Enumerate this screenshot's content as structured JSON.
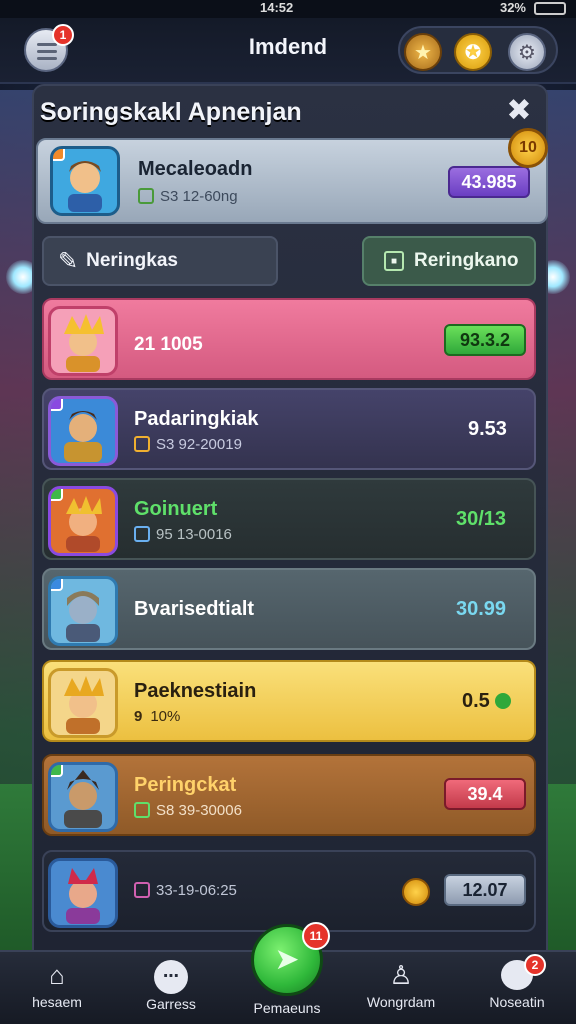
{
  "status_bar": {
    "time": "14:52",
    "right": "32%"
  },
  "header": {
    "title": "Imdend",
    "menu_badge": "1",
    "icons": [
      "star-icon",
      "badge-icon",
      "settings-icon"
    ]
  },
  "panel": {
    "title": "Soringskakl Apnenjan",
    "close_icon": "close-icon"
  },
  "profile": {
    "name": "Mecaleoadn",
    "sub": "S3 12-60ng",
    "score": "43.985",
    "rank": "10"
  },
  "tabs": [
    {
      "label": "Neringkas",
      "icon": "handshake-icon"
    },
    {
      "label": "Reringkano",
      "icon": "square-icon"
    }
  ],
  "rows": [
    {
      "name": "",
      "sub": "21 1005",
      "score": "93.3.2",
      "theme": "pink"
    },
    {
      "name": "Padaringkiak",
      "sub": "S3 92-20019",
      "score": "9.53",
      "theme": "purple"
    },
    {
      "name": "Goinuert",
      "sub": "95 13-0016",
      "score": "30/13",
      "theme": "dark"
    },
    {
      "name": "Bvarisedtialt",
      "sub": "",
      "score": "30.99",
      "theme": "slate"
    },
    {
      "name": "Paeknestiain",
      "sub": "10%",
      "score": "0.5",
      "theme": "yellow"
    },
    {
      "name": "Peringckat",
      "sub": "S8 39-30006",
      "score": "39.4",
      "theme": "brown"
    },
    {
      "name": "",
      "sub": "33-19-06:25",
      "score": "12.07",
      "theme": "night"
    }
  ],
  "bottom_nav": [
    {
      "label": "hesaem",
      "icon": "home-icon",
      "badge": ""
    },
    {
      "label": "Garress",
      "icon": "game-controller-icon",
      "badge": ""
    },
    {
      "label": "Pemaeuns",
      "icon": "play-icon",
      "badge": "11"
    },
    {
      "label": "Wongrdam",
      "icon": "bell-icon",
      "badge": ""
    },
    {
      "label": "Noseatin",
      "icon": "chat-icon",
      "badge": "2"
    }
  ],
  "colors": {
    "pink_row": "#e26b8f",
    "purple_row": "#3d3c5e",
    "yellow_row": "#f2cf5a",
    "brown_row": "#a6652c",
    "slate_row": "#4f5e66",
    "accent_green": "#3fd14a"
  }
}
